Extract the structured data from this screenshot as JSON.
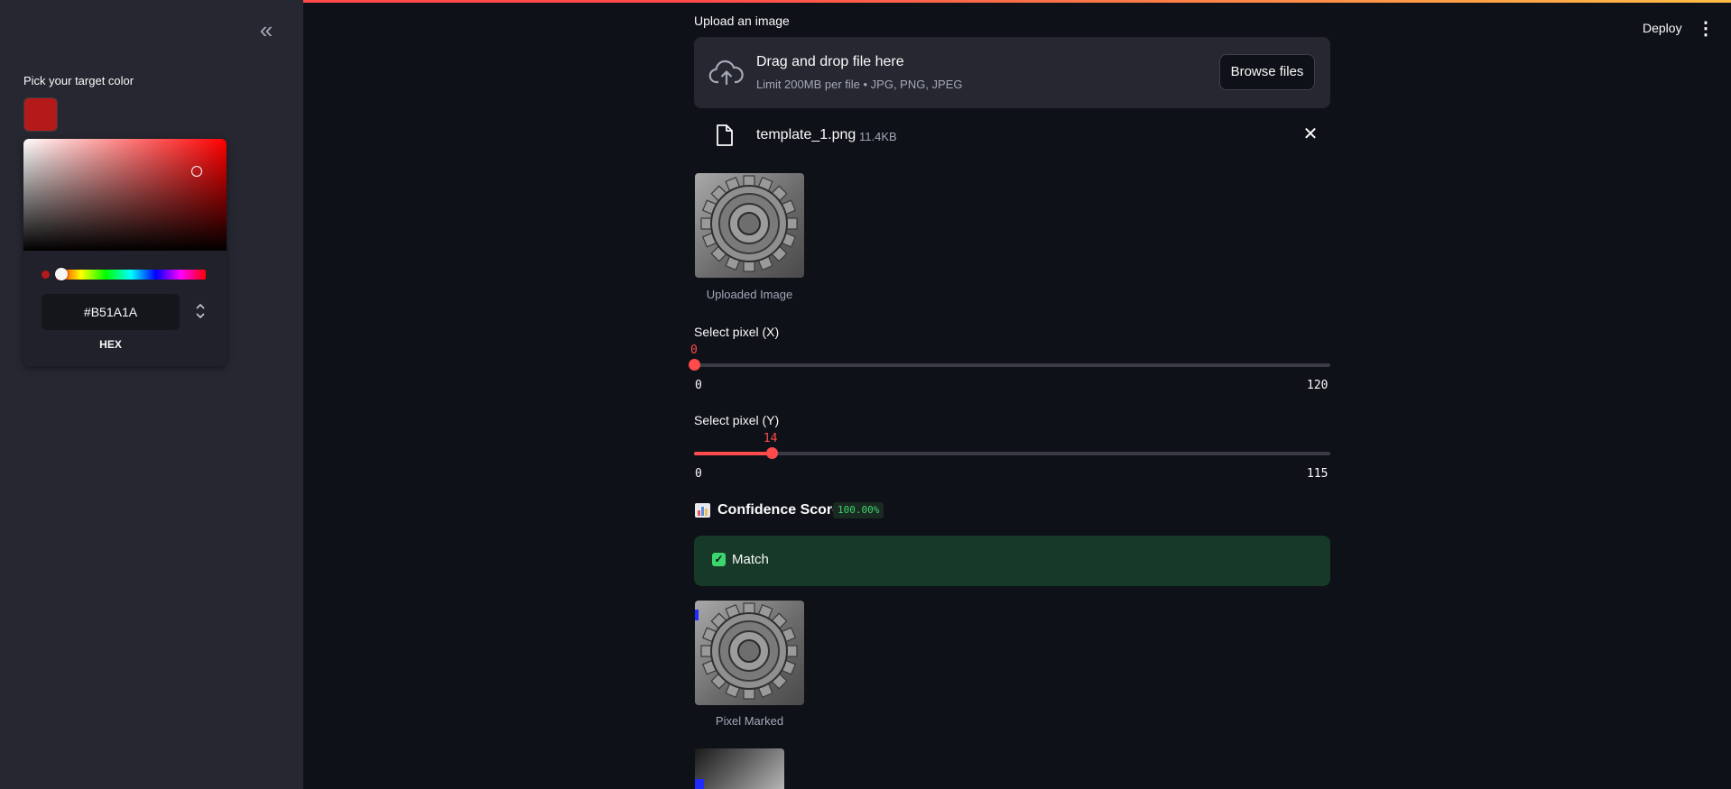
{
  "colors": {
    "accent": "#ff4b4b",
    "sidebar_bg": "#262730",
    "main_bg": "#0e1117",
    "success_bg": "#173928",
    "success_fg": "#3dd56d",
    "picked": "#B51A1A"
  },
  "sidebar": {
    "collapse_icon": "double-chevron-left-icon",
    "collapse_glyph": "«",
    "color_picker_label": "Pick your target color",
    "hex_value": "#B51A1A",
    "hex_label": "HEX",
    "format_toggle_icon": "up-down-chevron-icon"
  },
  "header": {
    "deploy_label": "Deploy",
    "menu_icon": "vertical-ellipsis-icon",
    "menu_glyph": "⋮"
  },
  "uploader": {
    "label": "Upload an image",
    "title": "Drag and drop file here",
    "subtitle": "Limit 200MB per file • JPG, PNG, JPEG",
    "browse_label": "Browse files",
    "upload_icon": "cloud-upload-icon",
    "file": {
      "name": "template_1.png",
      "size": "11.4KB",
      "file_icon": "file-icon",
      "close_glyph": "✕"
    }
  },
  "images": {
    "uploaded_caption": "Uploaded Image",
    "marked_caption": "Pixel Marked"
  },
  "slider_x": {
    "label": "Select pixel (X)",
    "value": 0,
    "value_text": "0",
    "min": 0,
    "max": 120,
    "min_text": "0",
    "max_text": "120"
  },
  "slider_y": {
    "label": "Select pixel (Y)",
    "value": 14,
    "value_text": "14",
    "min": 0,
    "max": 115,
    "min_text": "0",
    "max_text": "115"
  },
  "confidence": {
    "icon": "bar-chart-icon",
    "title": "Confidence Score:",
    "value": "100.00%"
  },
  "result": {
    "check_glyph": "✓",
    "message": "Match"
  }
}
